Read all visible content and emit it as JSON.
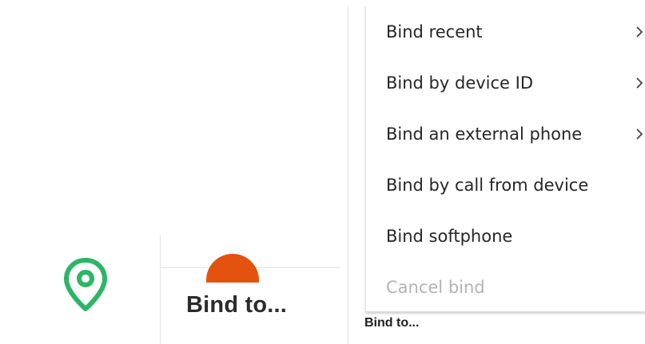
{
  "background": {
    "bind_to_primary": "Bind to...",
    "bind_to_secondary": "Bind to...",
    "location_icon": "map-pin-icon",
    "accent_green": "#2db567",
    "accent_orange": "#e4520f"
  },
  "context_menu": {
    "items": [
      {
        "label": "Bind recent",
        "has_submenu": true,
        "enabled": true
      },
      {
        "label": "Bind by device ID",
        "has_submenu": true,
        "enabled": true
      },
      {
        "label": "Bind an external phone",
        "has_submenu": true,
        "enabled": true
      },
      {
        "label": "Bind by call from device",
        "has_submenu": false,
        "enabled": true
      },
      {
        "label": "Bind softphone",
        "has_submenu": false,
        "enabled": true
      },
      {
        "label": "Cancel bind",
        "has_submenu": false,
        "enabled": false
      }
    ],
    "chevron_icon": "chevron-right-icon"
  }
}
